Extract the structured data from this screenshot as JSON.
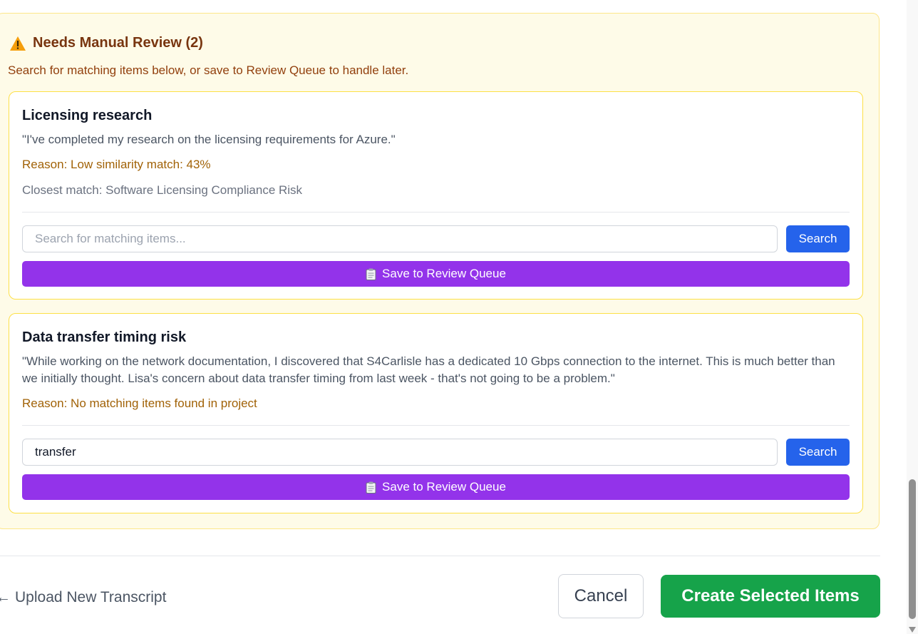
{
  "review": {
    "title": "Needs Manual Review (2)",
    "subtitle": "Search for matching items below, or save to Review Queue to handle later.",
    "items": [
      {
        "title": "Licensing research",
        "quote": "\"I've completed my research on the licensing requirements for Azure.\"",
        "reason": "Reason: Low similarity match: 43%",
        "closest": "Closest match: Software Licensing Compliance Risk",
        "search_value": "",
        "search_placeholder": "Search for matching items...",
        "search_label": "Search",
        "save_label": "Save to Review Queue"
      },
      {
        "title": "Data transfer timing risk",
        "quote": "\"While working on the network documentation, I discovered that S4Carlisle has a dedicated 10 Gbps connection to the internet. This is much better than we initially thought. Lisa's concern about data transfer timing from last week - that's not going to be a problem.\"",
        "reason": "Reason: No matching items found in project",
        "search_value": "transfer",
        "search_placeholder": "Search for matching items...",
        "search_label": "Search",
        "save_label": "Save to Review Queue"
      }
    ]
  },
  "footer": {
    "upload_arrow": "←",
    "upload_label": "Upload New Transcript",
    "cancel_label": "Cancel",
    "create_label": "Create Selected Items"
  },
  "icons": {
    "warning": "warning-icon",
    "save": "clipboard-icon",
    "upload": "arrow-left-icon"
  },
  "colors": {
    "panel_bg": "#fefbe8",
    "panel_border": "#fde68a",
    "title": "#78350f",
    "reason": "#a16207",
    "search_button": "#2563eb",
    "save_button": "#9333ea",
    "create_button": "#16a34a"
  }
}
